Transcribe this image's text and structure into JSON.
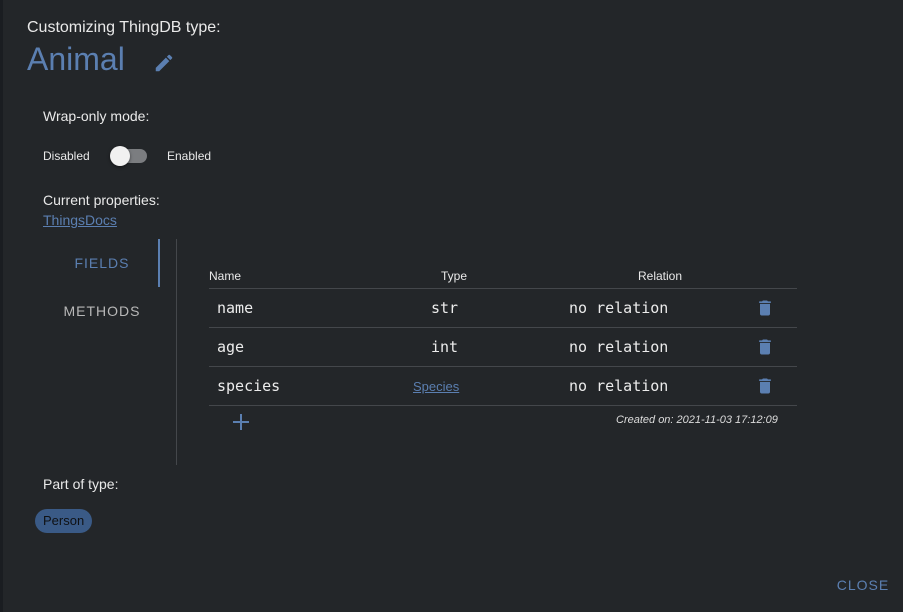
{
  "header": {
    "subtitle": "Customizing ThingDB type:",
    "type_name": "Animal"
  },
  "wrap_only": {
    "label": "Wrap-only mode:",
    "off_label": "Disabled",
    "on_label": "Enabled",
    "enabled": false
  },
  "properties": {
    "label": "Current properties:",
    "docs_link": "ThingsDocs"
  },
  "tabs": [
    {
      "label": "FIELDS",
      "active": true
    },
    {
      "label": "METHODS",
      "active": false
    }
  ],
  "fields_table": {
    "columns": [
      "Name",
      "Type",
      "Relation"
    ],
    "rows": [
      {
        "name": "name",
        "type": "str",
        "relation": "no relation"
      },
      {
        "name": "age",
        "type": "int",
        "relation": "no relation"
      },
      {
        "name": "species",
        "type": "Species",
        "relation": "no relation"
      }
    ],
    "created": "Created on: 2021-11-03 17:12:09"
  },
  "part_of_type": {
    "label": "Part of type:",
    "chips": [
      "Person"
    ]
  },
  "footer": {
    "close_label": "CLOSE"
  },
  "icons": {
    "edit": "pencil-icon",
    "delete": "trash-icon",
    "add": "plus-icon"
  },
  "colors": {
    "accent": "#5b7fb1",
    "background": "#232629",
    "chip": "#3a5a86"
  }
}
